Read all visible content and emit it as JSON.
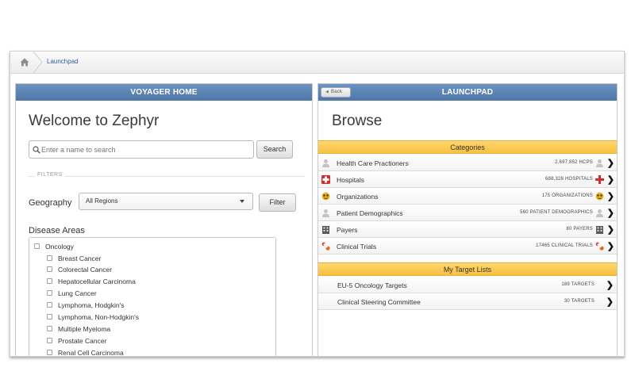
{
  "breadcrumb": {
    "home_icon": "home-icon",
    "current": "Launchpad"
  },
  "left_panel": {
    "header": "VOYAGER HOME",
    "welcome": "Welcome to Zephyr",
    "search": {
      "placeholder": "Enter a name to search",
      "button": "Search"
    },
    "filters_label": "FILTERS",
    "geography": {
      "label": "Geography",
      "selected": "All Regions",
      "button": "Filter"
    },
    "disease_areas": {
      "title": "Disease Areas",
      "parent": "Oncology",
      "items": [
        "Breast Cancer",
        "Colorectal Cancer",
        "Hepatocellular Carcinoma",
        "Lung Cancer",
        "Lymphoma, Hodgkin's",
        "Lymphoma, Non-Hodgkin's",
        "Multiple Myeloma",
        "Prostate Cancer",
        "Renal Cell Carcinoma"
      ]
    }
  },
  "right_panel": {
    "header": "LAUNCHPAD",
    "back": "Back",
    "browse": "Browse",
    "categories_title": "Categories",
    "categories": [
      {
        "label": "Health Care Practioners",
        "count": "2,697,852 HCPS",
        "icon": "person-icon"
      },
      {
        "label": "Hospitals",
        "count": "688,328 HOSPITALS",
        "icon": "red-cross-icon"
      },
      {
        "label": "Organizations",
        "count": "175 ORGANIZATIONS",
        "icon": "group-icon"
      },
      {
        "label": "Patient Demographics",
        "count": "560 PATIENT DEMOGRAPHICS",
        "icon": "patient-icon"
      },
      {
        "label": "Payers",
        "count": "80 PAYERS",
        "icon": "building-icon"
      },
      {
        "label": "Clinical Trials",
        "count": "17465 CLINICAL TRIALS",
        "icon": "pill-icon"
      }
    ],
    "target_lists_title": "My Target Lists",
    "target_lists": [
      {
        "label": "EU-5 Oncology Targets",
        "count": "189 TARGETS"
      },
      {
        "label": "Clinical Steering Committee",
        "count": "30 TARGETS"
      }
    ]
  }
}
